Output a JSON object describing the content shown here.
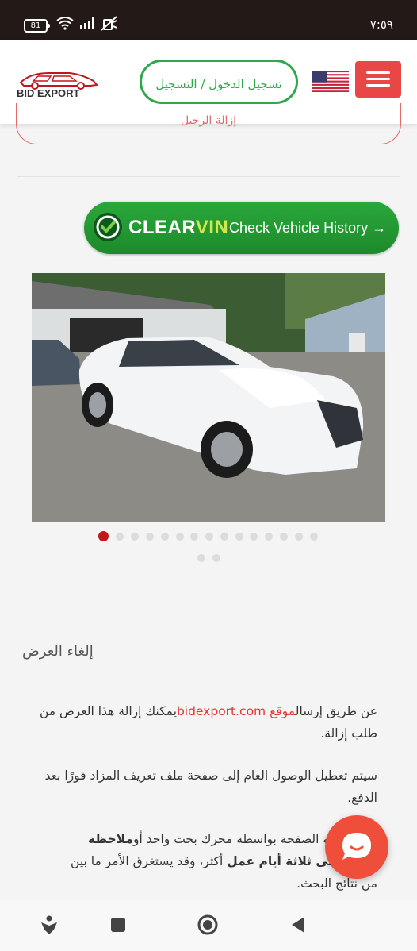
{
  "status_bar": {
    "time": "٧:٥٩",
    "battery": "81",
    "icons": [
      "wifi-icon",
      "signal-icon",
      "muted-icon"
    ]
  },
  "header": {
    "logo_text": "BID EXPORT",
    "login_label": "تسجيل الدخول / التسجيل",
    "flag": "us-flag-icon",
    "menu_icon": "hamburger-menu-icon"
  },
  "prev_button_label": "إزالة الرجيل",
  "clearvin": {
    "brand_clear": "CLEAR",
    "brand_vin": "VIN",
    "cta": "Check Vehicle History →"
  },
  "gallery": {
    "image_alt": "White sedan with front-end damage",
    "slide_count": 17,
    "active_index": 0
  },
  "content": {
    "heading": "إلغاء العرض",
    "p1_before": "عن طريق إرسال",
    "p1_link": "موقع bidexport.com",
    "p1_after": "يمكنك إزالة هذا العرض من طلب إزالة.",
    "p2": "سيتم تعطيل الوصول العام إلى صفحة ملف تعريف المزاد فورًا بعد الدفع.",
    "p3_start": "تتم فهرسة الصفحة بواسطة محرك بحث واحد أو",
    "p3_bold1": "ملاحظة",
    "p3_mid": "يومين إلى ثلاثة أيام عمل",
    "p3_end": "أكثر، وقد يستغرق الأمر ما بين",
    "p3_last": "من نتائج البحث."
  },
  "colors": {
    "accent_red": "#e94646",
    "green": "#2ea84a",
    "link_red": "#e23535",
    "status_bar": "#231916"
  },
  "nav_bar": {
    "icons": [
      "accessibility-icon",
      "recents-icon",
      "home-icon",
      "back-icon"
    ]
  }
}
